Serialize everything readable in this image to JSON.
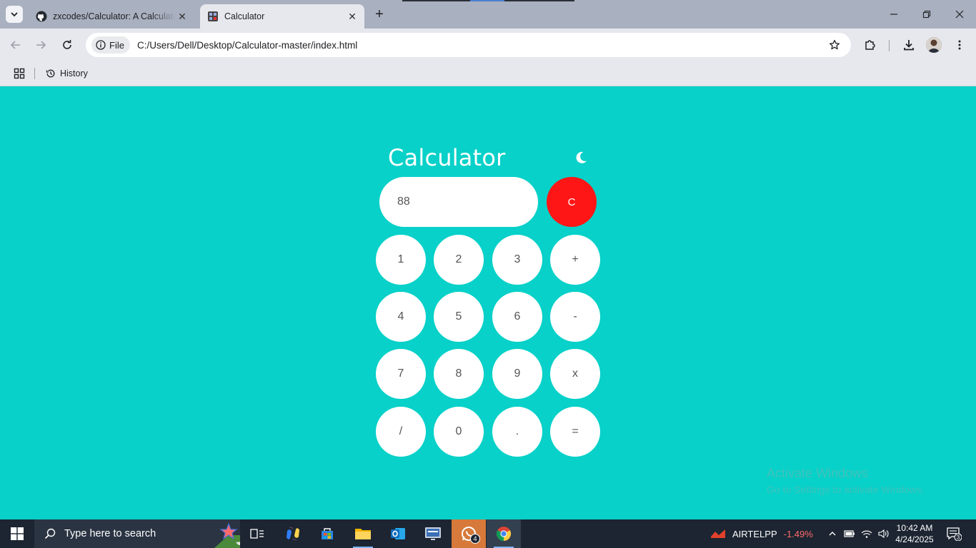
{
  "browser": {
    "tabs": [
      {
        "title": "zxcodes/Calculator: A Calculator",
        "favicon": "github-icon"
      },
      {
        "title": "Calculator",
        "favicon": "calculator-favicon-icon"
      }
    ],
    "address": {
      "chip_label": "File",
      "url": "C:/Users/Dell/Desktop/Calculator-master/index.html"
    },
    "bookmarks": {
      "history_label": "History"
    }
  },
  "calculator": {
    "title": "Calculator",
    "display_value": "88",
    "clear_label": "C",
    "theme_icon": "moon-icon",
    "keys": [
      "1",
      "2",
      "3",
      "+",
      "4",
      "5",
      "6",
      "-",
      "7",
      "8",
      "9",
      "x",
      "/",
      "0",
      ".",
      "="
    ],
    "colors": {
      "background": "#07d1c9",
      "clear": "#fe1616",
      "key": "#ffffff"
    }
  },
  "watermark": {
    "line1": "Activate Windows",
    "line2": "Go to Settings to activate Windows."
  },
  "taskbar": {
    "search_placeholder": "Type here to search",
    "whatsapp_badge": "4",
    "stock": {
      "ticker": "AIRTELPP",
      "change": "-1.49%"
    },
    "clock": {
      "time": "10:42 AM",
      "date": "4/24/2025"
    },
    "notifications_count": "3"
  }
}
